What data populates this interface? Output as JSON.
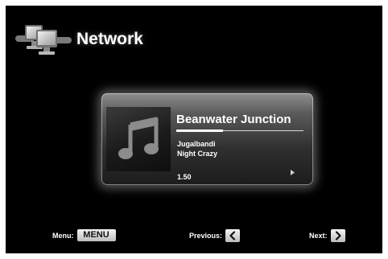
{
  "header": {
    "title": "Network",
    "icon": "network-computers-icon"
  },
  "now_playing": {
    "title": "Beanwater Junction",
    "artist": "Jugalbandi",
    "album": "Night Crazy",
    "elapsed": "1.50",
    "progress": 0.37,
    "art_icon": "music-note-icon",
    "status_icon": "play-icon"
  },
  "footer": {
    "menu_label": "Menu:",
    "menu_key": "MENU",
    "previous_label": "Previous:",
    "previous_icon": "chevron-left-icon",
    "next_label": "Next:",
    "next_icon": "chevron-right-icon"
  }
}
